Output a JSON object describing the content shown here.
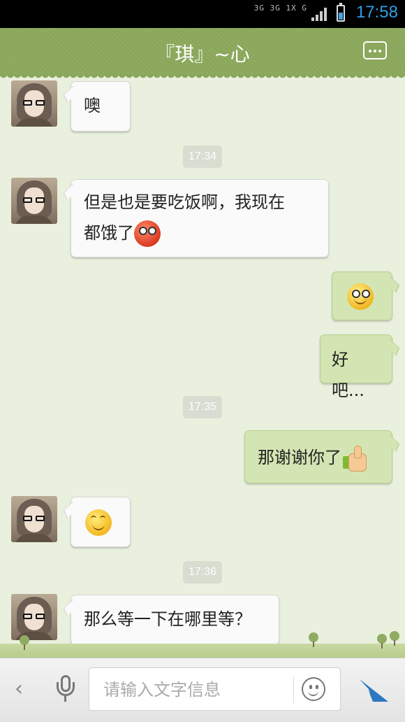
{
  "status_bar": {
    "network_labels": [
      "3G",
      "3G",
      "1X",
      "G"
    ],
    "time": "17:58",
    "battery_level": 0.5,
    "accent_color": "#2f9fe6"
  },
  "header": {
    "title": "『琪』~心",
    "more_icon": "more-dots-icon",
    "background_color": "#8aa75a"
  },
  "messages": [
    {
      "side": "left",
      "text": "噢"
    },
    {
      "timestamp": "17:34"
    },
    {
      "side": "left",
      "text_line1": "但是也是要吃饭啊，我现在",
      "text_line2": "都饿了",
      "emoji": "blush-emoji-icon"
    },
    {
      "side": "right",
      "emoji": "angry-emoji-icon"
    },
    {
      "side": "right",
      "text": "好吧..."
    },
    {
      "timestamp": "17:35"
    },
    {
      "side": "right",
      "text": "那谢谢你了",
      "emoji": "thumbs-up-icon"
    },
    {
      "side": "left",
      "emoji": "smile-emoji-icon"
    },
    {
      "timestamp": "17:36"
    },
    {
      "side": "left",
      "text": "那么等一下在哪里等？"
    }
  ],
  "colors": {
    "incoming_bubble": "#fafafa",
    "outgoing_bubble": "#d3e5b2",
    "chat_background": "#e9f0dd"
  },
  "input_bar": {
    "placeholder": "请输入文字信息",
    "value": "",
    "icons": [
      "back-chevron-icon",
      "microphone-icon",
      "emoji-face-icon",
      "send-icon"
    ]
  }
}
